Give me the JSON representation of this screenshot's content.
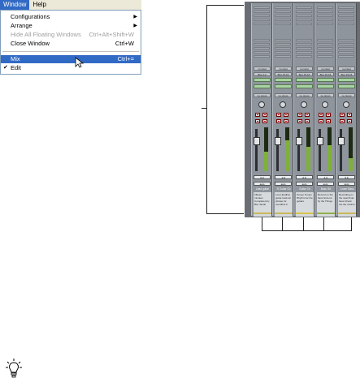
{
  "menubar": {
    "items": [
      {
        "label": "Window",
        "active": true
      },
      {
        "label": "Help",
        "active": false
      }
    ]
  },
  "window_menu": {
    "items": [
      {
        "label": "Configurations",
        "shortcut": "",
        "submenu": true,
        "disabled": false,
        "checked": false,
        "highlighted": false
      },
      {
        "label": "Arrange",
        "shortcut": "",
        "submenu": true,
        "disabled": false,
        "checked": false,
        "highlighted": false
      },
      {
        "label": "Hide All Floating Windows",
        "shortcut": "Ctrl+Alt+Shift+W",
        "submenu": false,
        "disabled": true,
        "checked": false,
        "highlighted": false
      },
      {
        "label": "Close Window",
        "shortcut": "Ctrl+W",
        "submenu": false,
        "disabled": false,
        "checked": false,
        "highlighted": false
      },
      {
        "label": "Mix",
        "shortcut": "Ctrl+=",
        "submenu": false,
        "disabled": false,
        "checked": false,
        "highlighted": true
      },
      {
        "label": "Edit",
        "shortcut": "",
        "submenu": false,
        "disabled": false,
        "checked": true,
        "highlighted": false
      }
    ]
  },
  "mix_window": {
    "strips": [
      {
        "name": "Lead guitar",
        "bus": "Bus 1-2",
        "input": "no input",
        "group": "no group",
        "volume": "0.0",
        "level": 0.45,
        "comment": "Fifteen minutes Completed by Ben Jacob",
        "color": "#c9b85a"
      },
      {
        "name": "R Guitar Ch",
        "bus": "Bus 15-16",
        "input": "no input",
        "group": "no group",
        "volume": "-2.4",
        "level": 0.7,
        "comment": "Low Headline guitar track all phrase for overdrive F",
        "color": "#c9b85a"
      },
      {
        "name": "Guitar Ch",
        "bus": "Bus 15-16",
        "input": "no input",
        "group": "no group",
        "volume": "0.0",
        "level": 0.55,
        "comment": "Tempo Tempo Rhythm for the guitars",
        "color": "#d8c44a"
      },
      {
        "name": "Bass Gtr",
        "bus": "Bus 15-16",
        "input": "no input",
        "group": "no group",
        "volume": "-1.2",
        "level": 0.6,
        "comment": "Record on the bass Sub-cut by the Things",
        "color": "#8fb04a"
      },
      {
        "name": "Lower Bass",
        "bus": "Bus 15-16",
        "input": "no input",
        "group": "no group",
        "volume": "0.0",
        "level": 0.3,
        "comment": "Recording on the neat Final bass Check out the volume",
        "color": "#c9b85a"
      }
    ],
    "auto_label": "auto"
  },
  "tip_icon": "lightbulb-icon"
}
